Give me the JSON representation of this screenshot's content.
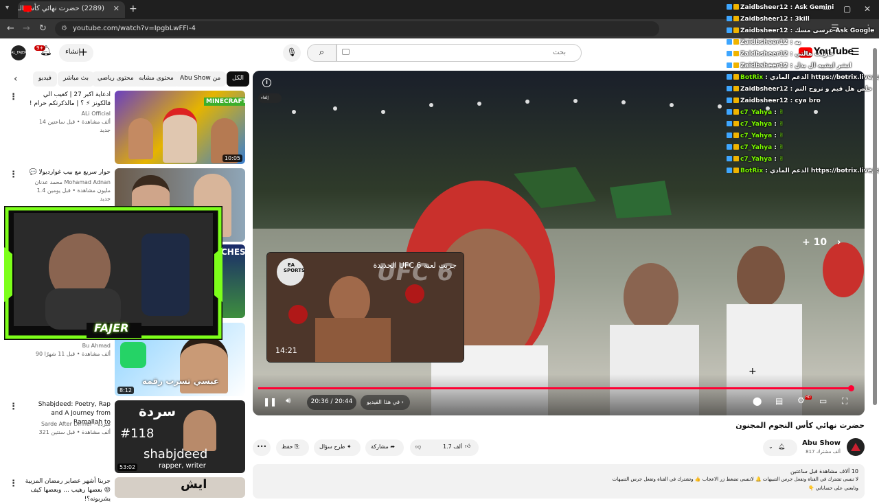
{
  "browser": {
    "tab_title": "(2289) حضرت نهائي كأس الـ",
    "tab_close": "✕",
    "new_tab": "+",
    "url": "youtube.com/watch?v=Ipgb​LwFFI-4",
    "win_min": "—",
    "win_max": "▢",
    "win_close": "✕"
  },
  "header": {
    "search_placeholder": "بحث",
    "create_label": "إنشاء",
    "notif_count": "9+",
    "logo_text": "YouTube",
    "avatar_text": "AL_FAJER"
  },
  "chips": [
    {
      "label": "الكل",
      "selected": true
    },
    {
      "label": "من Abu Show",
      "selected": false
    },
    {
      "label": "محتوى مشابه",
      "selected": false
    },
    {
      "label": "محتوى رياضي",
      "selected": false
    },
    {
      "label": "بث مباشر",
      "selected": false
    },
    {
      "label": "فيديو",
      "selected": false
    }
  ],
  "recommendations": [
    {
      "title": "ادعاية اكبر 27 | كعيب الي فالكونز ⚡ ؟ | مالذكرتكم حرام !",
      "channel": "ALi Official",
      "meta": "14 ألف مشاهدة • قبل ساعتين",
      "extra": "جديد",
      "duration": "10:05"
    },
    {
      "title": "حوار سريع مع بيب غوارديولا 💬",
      "channel": "محمد عدنان Mohamad Adnan",
      "meta": "1.4 مليون مشاهدة • قبل يومين",
      "extra": "جديد",
      "duration": ""
    },
    {
      "title": "",
      "channel": "Bu Ahmad",
      "meta": "90 ألف مشاهدة • قبل 11 شهرًا",
      "extra": "",
      "duration": "8:12"
    },
    {
      "title": "Shabjdeed: Poetry, Rap and A Journey from Ramallah to",
      "channel": "Sarde After Dinner - سردة",
      "meta": "321 ألف مشاهدة • قبل سنتين",
      "extra": "",
      "duration": "53:02"
    },
    {
      "title": "جربنا أشهر عصاير رمضان المزيية 😝 بعضها رهيب ... وبعضها كيف يشربونه؟!",
      "channel": "",
      "meta": "",
      "extra": "",
      "duration": ""
    }
  ],
  "thumb_texts": {
    "t1_badge": "MINECRAFT",
    "t3_caption": "عبسي تسرب رقمه",
    "t4_ar": "سردة",
    "t4_num": "#118",
    "t4_name": "shabjdeed",
    "t4_role": "rapper, writer",
    "t5_word": "ايش",
    "t2b_word": "CHES"
  },
  "player": {
    "time": "20:36 / 20:44",
    "chapter": "في هذا الفيديو",
    "skip": "+ 10",
    "caption_badge": "إلغاء",
    "progress_fraction": 0.985,
    "endcard_title": "جربت لعبة UFC 6 الجديدة",
    "endcard_duration": "14:21",
    "endcard_logo": "EA SPORTS",
    "endcard_game": "UFC 6",
    "hd_badge": "HD"
  },
  "chat": [
    {
      "user": "Zaidbsheer12",
      "msg": "Ask Gemini",
      "bot": false
    },
    {
      "user": "Zaidbsheer12",
      "msg": "3kill",
      "bot": false
    },
    {
      "user": "Zaidbsheer12",
      "msg": "عرسى مسك Ask Google",
      "bot": false
    },
    {
      "user": "Zaidbsheer12",
      "msg": "يه",
      "bot": false
    },
    {
      "user": "Zaidbsheer12",
      "msg": "حاولت هالتي",
      "bot": false
    },
    {
      "user": "Zaidbsheer12",
      "msg": "انشر ايشيه ال بذل",
      "bot": false
    },
    {
      "user": "BotRix",
      "msg": "الدعم المادي https://botrix.live/k/fajer2/tip",
      "bot": true
    },
    {
      "user": "Zaidbsheer12",
      "msg": "خلص هل قيم و نروح النم",
      "bot": false
    },
    {
      "user": "Zaidbsheer12",
      "msg": "cya bro",
      "bot": false
    },
    {
      "user": "c7_Yahya",
      "msg": "✌",
      "bot": false,
      "green": true
    },
    {
      "user": "c7_Yahya",
      "msg": "✌",
      "bot": false,
      "green": true
    },
    {
      "user": "c7_Yahya",
      "msg": "✌",
      "bot": false,
      "green": true
    },
    {
      "user": "c7_Yahya",
      "msg": "✌",
      "bot": false,
      "green": true
    },
    {
      "user": "c7_Yahya",
      "msg": "✌",
      "bot": false,
      "green": true
    },
    {
      "user": "BotRix",
      "msg": "الدعم المادي https://botrix.live/k/fajer2/tip",
      "bot": true
    }
  ],
  "webcam": {
    "name": "FAJER"
  },
  "video": {
    "title": "حضرت نهائي كأس النجوم المجنون",
    "channel": "Abu Show",
    "subs": "817 ألف مشترك",
    "likes": "1.7 ألف",
    "share": "مشاركة",
    "ask": "طرح سؤال",
    "save": "حفظ",
    "more": "•••"
  },
  "description": {
    "line1": "10 آلاف مشاهدة قبل ساعتين",
    "line2": "لا تنسى تشترك في القناة وتفعل جرس التنبيهات 🔔 لاتنسى تضغط زر الاعجاب 👍 وتشترك في القناة وتفعل جرس التنبيهات",
    "line3": "وتابعني على حساباتي 👇"
  },
  "colors": {
    "accent_red": "#ff0033",
    "yt_red": "#ff0000",
    "chat_green": "#7cfc00",
    "frame_green": "#7dff1a"
  }
}
